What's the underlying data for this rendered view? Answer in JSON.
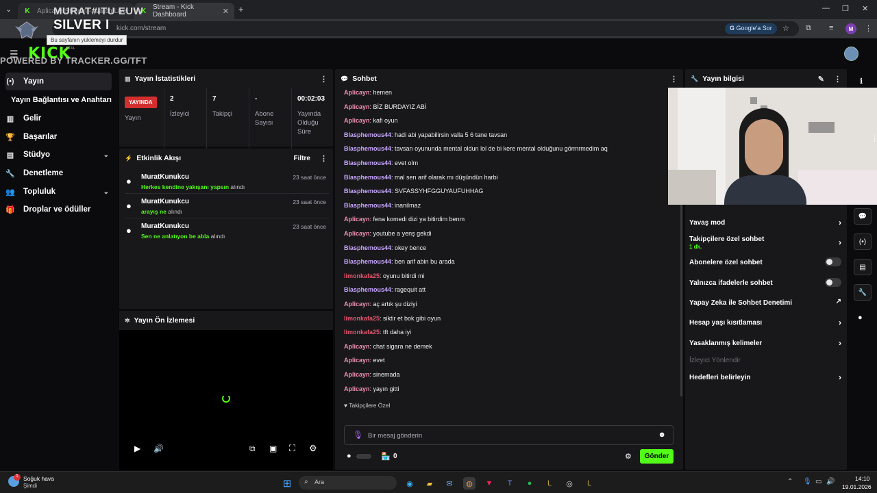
{
  "browser": {
    "tabs": [
      {
        "label": "Aplicayn Stream - Watch Live"
      },
      {
        "label": "Stream - Kick Dashboard"
      }
    ],
    "new_tab": "+",
    "url": "kick.com/stream",
    "google_button": "Google'a Sor",
    "profile_initial": "M",
    "tooltip": "Bu sayfanın yüklemeyi durdur"
  },
  "overlay": {
    "line1": "MURAT#ITU EUW",
    "line2": "SILVER I",
    "line3": "POWERED BY TRACKER.GG/TFT"
  },
  "kick": {
    "logo": "KICK",
    "beta": "BETA"
  },
  "sidebar": {
    "items": [
      {
        "label": "Yayın",
        "icon": "broadcast-icon"
      },
      {
        "label": "Yayın Bağlantısı ve Anahtarı",
        "icon": ""
      },
      {
        "label": "Gelir",
        "icon": "chart-icon"
      },
      {
        "label": "Başarılar",
        "icon": "trophy-icon"
      },
      {
        "label": "Stüdyo",
        "icon": "studio-icon"
      },
      {
        "label": "Denetleme",
        "icon": "wrench-icon"
      },
      {
        "label": "Topluluk",
        "icon": "community-icon"
      },
      {
        "label": "Droplar ve ödüller",
        "icon": "gift-icon"
      }
    ]
  },
  "stats": {
    "title": "Yayın İstatistikleri",
    "live_badge": "YAYINDA",
    "cells": [
      {
        "value": "",
        "label": "Yayın"
      },
      {
        "value": "2",
        "label": "İzleyici"
      },
      {
        "value": "7",
        "label": "Takipçi"
      },
      {
        "value": "-",
        "label": "Abone Sayısı"
      },
      {
        "value": "00:02:03",
        "label": "Yayında Olduğu Süre"
      }
    ]
  },
  "activity": {
    "title": "Etkinlik Akışı",
    "filter": "Filtre",
    "items": [
      {
        "name": "MuratKunukcu",
        "reward": "Herkes kendine yakışanı yapsın",
        "suffix": "alındı",
        "time": "23 saat önce"
      },
      {
        "name": "MuratKunukcu",
        "reward": "arayış ne",
        "suffix": "alındı",
        "time": "23 saat önce"
      },
      {
        "name": "MuratKunukcu",
        "reward": "Sen ne anlatıyon be abla",
        "suffix": "alındı",
        "time": "23 saat önce"
      }
    ]
  },
  "preview": {
    "title": "Yayın Ön İzlemesi"
  },
  "chat": {
    "title": "Sohbet",
    "colors": {
      "Aplicayn": "#f48fb1",
      "Blasphemous44": "#c9a6ff",
      "limonkafa25": "#e5556b"
    },
    "messages": [
      {
        "user": "Aplicayn",
        "text": "hemen"
      },
      {
        "user": "Aplicayn",
        "text": "BİZ BURDAYIZ ABİ"
      },
      {
        "user": "Aplicayn",
        "text": "kafi oyun"
      },
      {
        "user": "Blasphemous44",
        "text": "hadi abi yapabilirsin valla 5 6 tane tavsan"
      },
      {
        "user": "Blasphemous44",
        "text": "tavsan oyununda mental oldun lol de bi kere mental olduğunu görmrmedim aq"
      },
      {
        "user": "Blasphemous44",
        "text": "evet olm"
      },
      {
        "user": "Blasphemous44",
        "text": "mal sen arif olarak mı düşündün harbi"
      },
      {
        "user": "Blasphemous44",
        "text": "SVFASSYHFGGUYAUFUHHAG"
      },
      {
        "user": "Blasphemous44",
        "text": "inanilmaz"
      },
      {
        "user": "Aplicayn",
        "text": "fena komedi dizi ya bitirdim benm"
      },
      {
        "user": "Aplicayn",
        "text": "youtube a yenş gekdi"
      },
      {
        "user": "Blasphemous44",
        "text": "okey bence"
      },
      {
        "user": "Blasphemous44",
        "text": "ben arif abin bu arada"
      },
      {
        "user": "limonkafa25",
        "text": "oyunu bitirdi mi"
      },
      {
        "user": "Blasphemous44",
        "text": "ragequit att"
      },
      {
        "user": "Aplicayn",
        "text": "aç artık şu diziyi"
      },
      {
        "user": "limonkafa25",
        "text": "siktir et bok gibi oyun"
      },
      {
        "user": "limonkafa25",
        "text": "tft daha iyi"
      },
      {
        "user": "Aplicayn",
        "text": "chat sigara ne demek"
      },
      {
        "user": "Aplicayn",
        "text": "evet"
      },
      {
        "user": "Aplicayn",
        "text": "sinemada"
      },
      {
        "user": "Aplicayn",
        "text": "yayın gitti"
      }
    ],
    "followers_only": "Takipçilere Özel",
    "input_placeholder": "Bir mesaj gönderin",
    "points": "0",
    "send": "Gönder"
  },
  "info": {
    "title": "Yayın bilgisi",
    "items": [
      {
        "label": "Yavaş mod",
        "kind": "chevron"
      },
      {
        "label": "Takipçilere özel sohbet",
        "sub": "1 dk.",
        "kind": "chevron"
      },
      {
        "label": "Abonelere özel sohbet",
        "kind": "toggle"
      },
      {
        "label": "Yalnızca ifadelerle sohbet",
        "kind": "toggle"
      },
      {
        "label": "Yapay Zeka ile Sohbet Denetimi",
        "kind": "external"
      },
      {
        "label": "Hesap yaşı kısıtlaması",
        "kind": "chevron"
      },
      {
        "label": "Yasaklanmış kelimeler",
        "kind": "chevron"
      },
      {
        "label": "İzleyici Yönlendir",
        "kind": "disabled"
      },
      {
        "label": "Hedefleri belirleyin",
        "kind": "chevron"
      }
    ]
  },
  "taskbar": {
    "weather_title": "Soğuk hava",
    "weather_sub": "Şimdi",
    "weather_badge": "1",
    "search": "Ara",
    "time": "14:10",
    "date": "19.01.2026"
  }
}
